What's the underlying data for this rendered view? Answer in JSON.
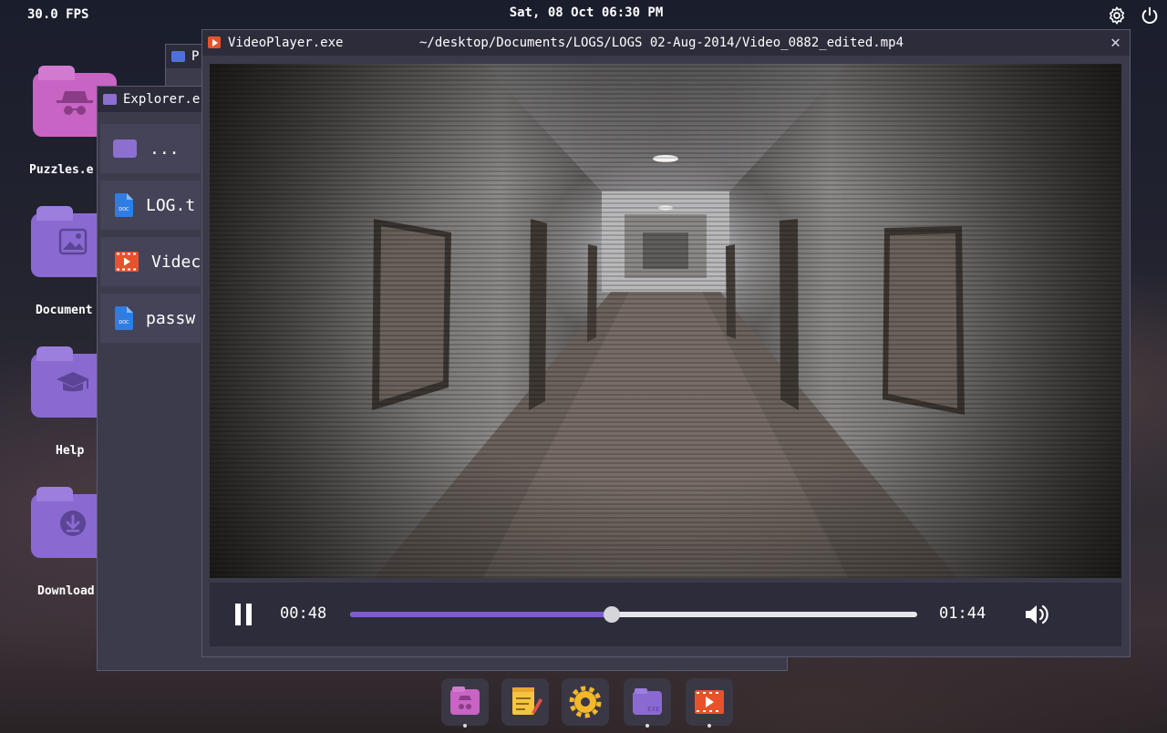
{
  "topbar": {
    "fps": "30.0 FPS",
    "clock": "Sat, 08 Oct 06:30 PM",
    "settings_icon": "gear-icon",
    "power_icon": "power-icon"
  },
  "desktop": {
    "icons": [
      {
        "label": "Puzzles.e",
        "icon": "spy-folder-icon",
        "color": "#c764c4"
      },
      {
        "label": "Document",
        "icon": "image-folder-icon",
        "color": "#8a6ad0"
      },
      {
        "label": "Help",
        "icon": "graduation-cap-folder-icon",
        "color": "#8a6ad0"
      },
      {
        "label": "Download",
        "icon": "download-folder-icon",
        "color": "#8a6ad0"
      }
    ]
  },
  "small_window": {
    "title": "P"
  },
  "explorer": {
    "title": "Explorer.e",
    "items": [
      {
        "label": "...",
        "icon": "folder-icon"
      },
      {
        "label": "LOG.t",
        "icon": "doc-file-icon"
      },
      {
        "label": "Videc",
        "icon": "video-file-icon"
      },
      {
        "label": "passw",
        "icon": "doc-file-icon"
      }
    ]
  },
  "player": {
    "app_name": "VideoPlayer.exe",
    "path": "~/desktop/Documents/LOGS/LOGS 02-Aug-2014/Video_0882_edited.mp4",
    "close_glyph": "✕",
    "current_time": "00:48",
    "total_time": "01:44",
    "progress": 0.4615,
    "accent": "#7e5bd0"
  },
  "dock": {
    "items": [
      {
        "name": "puzzles",
        "icon": "spy-folder-icon",
        "active": true
      },
      {
        "name": "notes",
        "icon": "notepad-icon",
        "active": false
      },
      {
        "name": "settings",
        "icon": "gear-icon",
        "active": false
      },
      {
        "name": "explorer",
        "icon": "exe-folder-icon",
        "active": true
      },
      {
        "name": "videoplayer",
        "icon": "video-player-icon",
        "active": true
      }
    ]
  }
}
